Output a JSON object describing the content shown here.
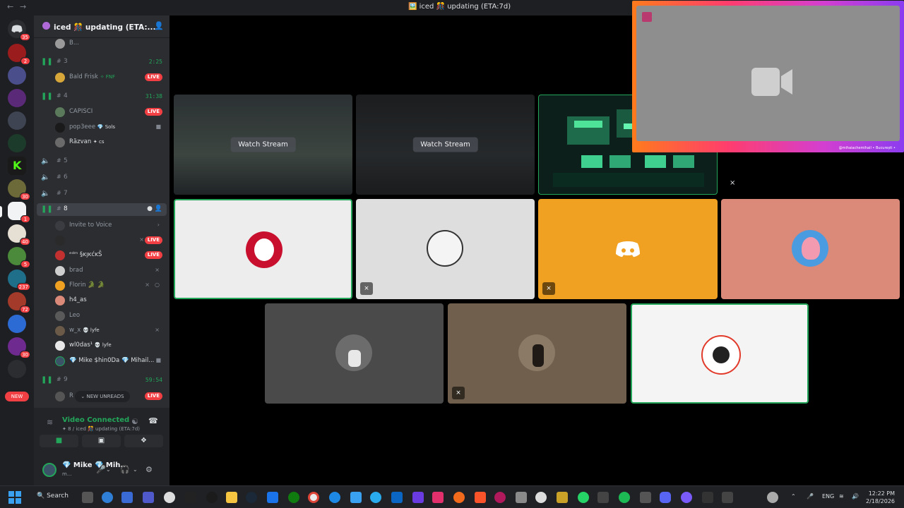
{
  "window": {
    "title": "🖼️ iced 🎊 updating (ETA:7d)"
  },
  "server": {
    "name": "iced 🎊 updating (ETA:..."
  },
  "channels": {
    "top_user": "B...",
    "ch3": {
      "name": "3",
      "time": "2:25",
      "user": "Bald Frisk",
      "user_tag": "✧ FNF"
    },
    "ch4": {
      "name": "4",
      "time": "31:38",
      "users": [
        "CAPISCI",
        "pop3eee",
        "Răzvan"
      ],
      "user_tags": [
        "",
        "💎 Sols",
        "✦ cs"
      ]
    },
    "ch5": {
      "name": "5"
    },
    "ch6": {
      "name": "6"
    },
    "ch7": {
      "name": "7"
    },
    "ch8": {
      "name": "8",
      "invite": "Invite to Voice",
      "users": [
        {
          "name": "",
          "tag": ""
        },
        {
          "name": "ᵉᵈᵐ §ĸı̧ĸćĸŠ",
          "tag": ""
        },
        {
          "name": "brad",
          "tag": ""
        },
        {
          "name": "Florin 🐊 🐊",
          "tag": ""
        },
        {
          "name": "h4_as",
          "tag": ""
        },
        {
          "name": "Leo",
          "tag": ""
        },
        {
          "name": "w_x",
          "tag": "💀 lyfe"
        },
        {
          "name": "wl0das¹",
          "tag": "💀 lyfe"
        },
        {
          "name": "💎 Mike $hin0Da 💎 Mihail...",
          "tag": ""
        }
      ]
    },
    "ch9": {
      "name": "9",
      "time": "59:54",
      "user": "R"
    }
  },
  "live_label": "LIVE",
  "new_unreads": "NEW UNREADS",
  "new_badge": "NEW",
  "voice": {
    "status": "Video Connected",
    "subtitle": "✦ 8 / iced 🎊 updating (ETA:7d)"
  },
  "user": {
    "name": "💎 Mike 💎 Mih...",
    "status": "m..."
  },
  "tiles": {
    "watch_label": "Watch Stream"
  },
  "camera": {
    "credit": "@mihaiachemihail • București •"
  },
  "guild_badges": [
    "35",
    "2",
    "",
    "",
    "",
    "",
    "",
    "30",
    "1",
    "40",
    "5",
    "237",
    "72",
    "",
    "30",
    ""
  ],
  "taskbar": {
    "search": "Search",
    "lang": "ENG",
    "time": "12:22 PM",
    "date": "2/18/2026"
  },
  "colors": {
    "online": "#23a55a",
    "live": "#f23f43",
    "discord_blurple": "#5865f2",
    "tile_orange": "#f0a122",
    "tile_pink": "#db8a79"
  }
}
